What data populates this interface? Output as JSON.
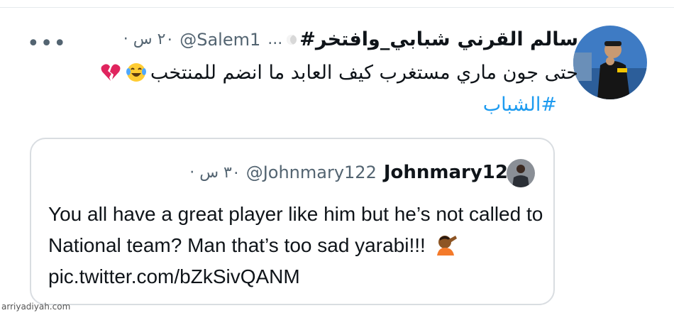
{
  "tweet": {
    "display_name": "سالم القرني",
    "display_name_extra": "#شبابي_وافتخر",
    "truncation": "...",
    "handle": "@Salem1",
    "time": "٢٠ س",
    "separator": "·",
    "text": "حتى جون ماري مستغرب كيف العابد ما انضم للمنتخب",
    "hashtag": "#الشباب",
    "emojis": [
      "tears-of-joy-emoji",
      "broken-heart-emoji"
    ]
  },
  "quoted_tweet": {
    "display_name": "Johnmary12",
    "handle": "@Johnmary122",
    "time": "٣٠ س",
    "separator": "·",
    "text_before_emoji": "You all have a great player like him but he’s not called to National team? Man that’s too sad yarabi!!!",
    "link": "pic.twitter.com/bZkSivQANM",
    "emoji": "facepalm-emoji"
  },
  "watermark": "arriyadiyah.com",
  "colors": {
    "link": "#1d9bf0",
    "secondary_text": "#536471",
    "border": "#d9dde1"
  }
}
